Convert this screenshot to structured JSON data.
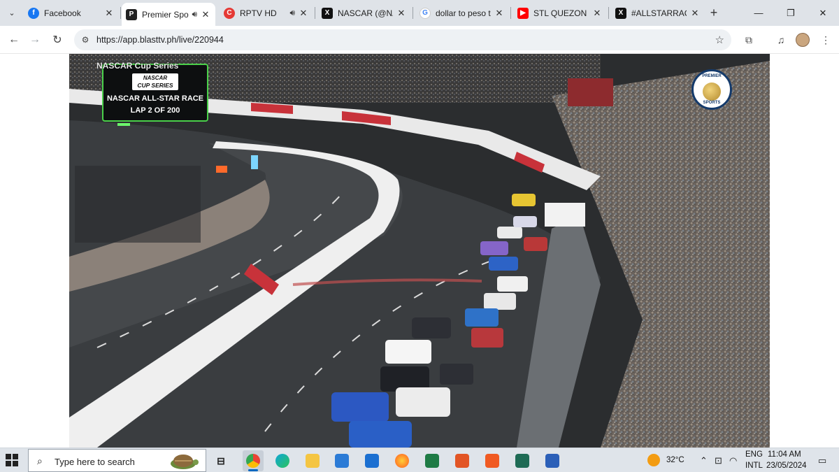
{
  "browser": {
    "tabs": [
      {
        "title": "Facebook",
        "favicon": "facebook-icon",
        "color": "#1877f2",
        "audio": false,
        "active": false
      },
      {
        "title": "Premier Spo",
        "favicon": "premier-sports-icon",
        "color": "#222222",
        "audio": true,
        "active": true
      },
      {
        "title": "RPTV HD",
        "favicon": "rptv-icon",
        "color": "#e53935",
        "audio": true,
        "active": false
      },
      {
        "title": "NASCAR (@NAS",
        "favicon": "x-icon",
        "color": "#111111",
        "audio": false,
        "active": false
      },
      {
        "title": "dollar to peso to",
        "favicon": "google-icon",
        "color": "#4285f4",
        "audio": false,
        "active": false
      },
      {
        "title": "STL QUEZON - Y",
        "favicon": "youtube-icon",
        "color": "#ff0000",
        "audio": false,
        "active": false
      },
      {
        "title": "#ALLSTARRACE",
        "favicon": "x-icon",
        "color": "#111111",
        "audio": false,
        "active": false
      }
    ],
    "new_tab_glyph": "+",
    "url": "https://app.blasttv.ph/live/220944"
  },
  "video": {
    "scorebug": {
      "series": "NASCAR Cup Series",
      "logo_line1": "NASCAR",
      "logo_line2": "CUP SERIES",
      "race": "NASCAR ALL-STAR RACE",
      "lap": "LAP 2 OF 200",
      "accent_color": "#4ad04a"
    },
    "network_logo": {
      "top": "PREMIER",
      "bottom": "SPORTS"
    }
  },
  "taskbar": {
    "search_placeholder": "Type here to search",
    "weather": "32°C",
    "language": "ENG",
    "layout": "INTL",
    "time": "11:04 AM",
    "date": "23/05/2024"
  }
}
